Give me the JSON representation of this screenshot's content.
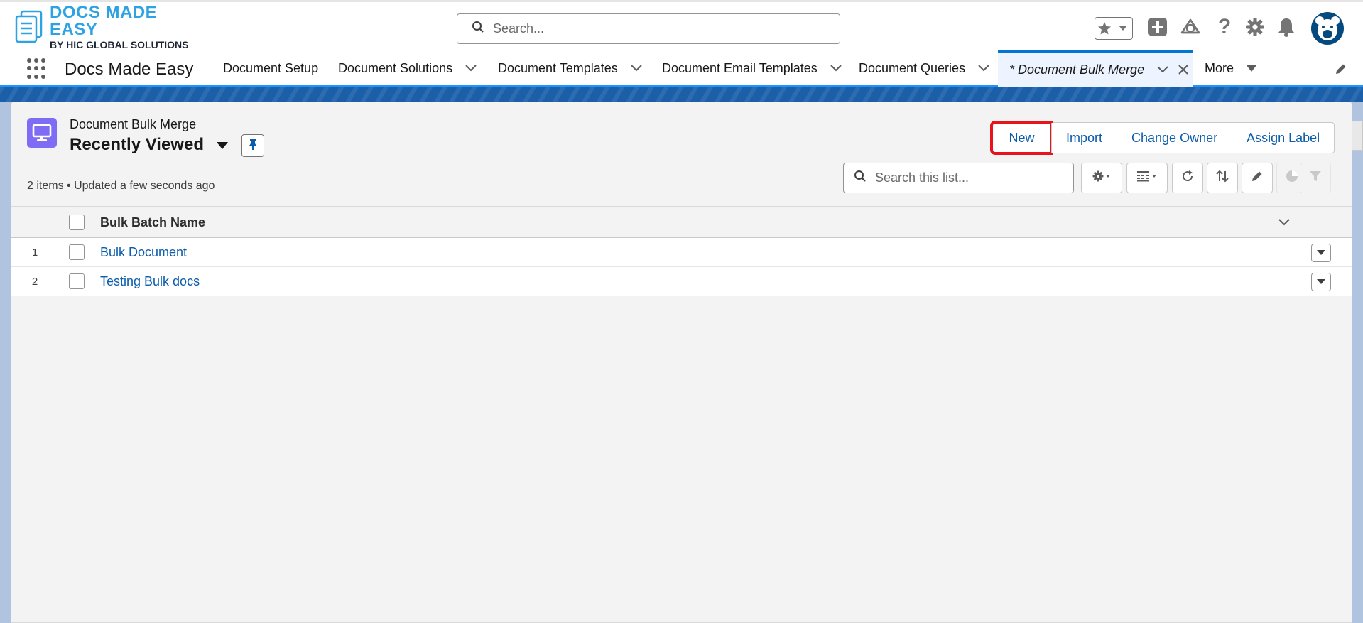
{
  "header": {
    "logo_title": "DOCS MADE EASY",
    "logo_subtitle": "BY HIC GLOBAL SOLUTIONS",
    "search_placeholder": "Search...",
    "icons": [
      "star-icon",
      "chevron-down-icon",
      "add-icon",
      "trailhead-icon",
      "help-icon",
      "setup-gear-icon",
      "notification-bell-icon",
      "avatar"
    ]
  },
  "nav": {
    "app_name": "Docs Made Easy",
    "items": [
      {
        "label": "Document Setup"
      },
      {
        "label": "Document Solutions"
      },
      {
        "label": "Document Templates"
      },
      {
        "label": "Document Email Templates"
      },
      {
        "label": "Document Queries"
      },
      {
        "label": "* Document Bulk Merge"
      },
      {
        "label": "More"
      }
    ]
  },
  "list": {
    "object_label": "Document Bulk Merge",
    "view_name": "Recently Viewed",
    "meta": "2 items • Updated a few seconds ago",
    "actions": {
      "new": "New",
      "import": "Import",
      "change_owner": "Change Owner",
      "assign_label": "Assign Label"
    },
    "search_placeholder": "Search this list...",
    "columns": [
      "Bulk Batch Name"
    ],
    "rows": [
      {
        "num": "1",
        "name": "Bulk Document"
      },
      {
        "num": "2",
        "name": "Testing Bulk docs"
      }
    ]
  },
  "colors": {
    "brand": "#0176d3",
    "link": "#0b5cab",
    "highlight": "#e8141b",
    "object_icon": "#7f6cf5"
  }
}
